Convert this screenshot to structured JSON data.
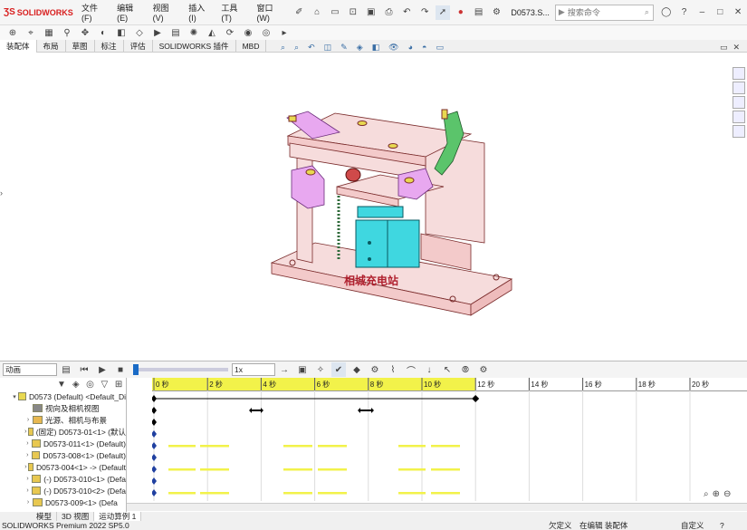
{
  "app": {
    "logo_text": "SOLIDWORKS",
    "menu": [
      "文件(F)",
      "编辑(E)",
      "视图(V)",
      "插入(I)",
      "工具(T)",
      "窗口(W)"
    ],
    "document_name": "D0573.S...",
    "search_placeholder": "搜索命令"
  },
  "command_tabs": [
    "装配体",
    "布局",
    "草图",
    "标注",
    "评估",
    "SOLIDWORKS 插件",
    "MBD"
  ],
  "model": {
    "label_text": "相城充电站"
  },
  "motion": {
    "study_type": "动画",
    "playback_speed": "1x",
    "time_ticks": [
      "0 秒",
      "2 秒",
      "4 秒",
      "6 秒",
      "8 秒",
      "10 秒",
      "12 秒",
      "14 秒",
      "16 秒",
      "18 秒",
      "20 秒"
    ],
    "tree": [
      {
        "label": "D0573 (Default) <Default_Di",
        "expand": "▾",
        "icon": "assembly-icon"
      },
      {
        "label": "视向及相机视图",
        "expand": "",
        "icon": "camera-icon"
      },
      {
        "label": "光源、相机与布景",
        "expand": "›",
        "icon": "lights-icon"
      },
      {
        "label": "(固定) D0573-01<1> (默认",
        "expand": "›",
        "icon": "part-icon"
      },
      {
        "label": "D0573-011<1> (Default)",
        "expand": "›",
        "icon": "part-icon"
      },
      {
        "label": "D0573-008<1> (Default)",
        "expand": "›",
        "icon": "part-icon"
      },
      {
        "label": "D0573-004<1> -> (Default",
        "expand": "›",
        "icon": "part-icon"
      },
      {
        "label": "(-) D0573-010<1> (Defa",
        "expand": "›",
        "icon": "part-icon"
      },
      {
        "label": "(-) D0573-010<2> (Defa",
        "expand": "›",
        "icon": "part-icon"
      },
      {
        "label": "D0573-009<1> (Defa",
        "expand": "›",
        "icon": "part-icon"
      }
    ]
  },
  "bottom_tabs": [
    "模型",
    "3D 视图",
    "运动算例 1"
  ],
  "status": {
    "version": "SOLIDWORKS Premium 2022 SP5.0",
    "constraint": "欠定义",
    "mode": "在编辑 装配体",
    "units": "自定义"
  },
  "colors": {
    "base": "#f6dcdc",
    "cylinder": "#3fd7e0",
    "clamp_pink": "#e8a8f0",
    "clamp_green": "#5bc46b",
    "timeline_yellow": "#f2f24a",
    "accent_blue": "#1a6bc6"
  }
}
